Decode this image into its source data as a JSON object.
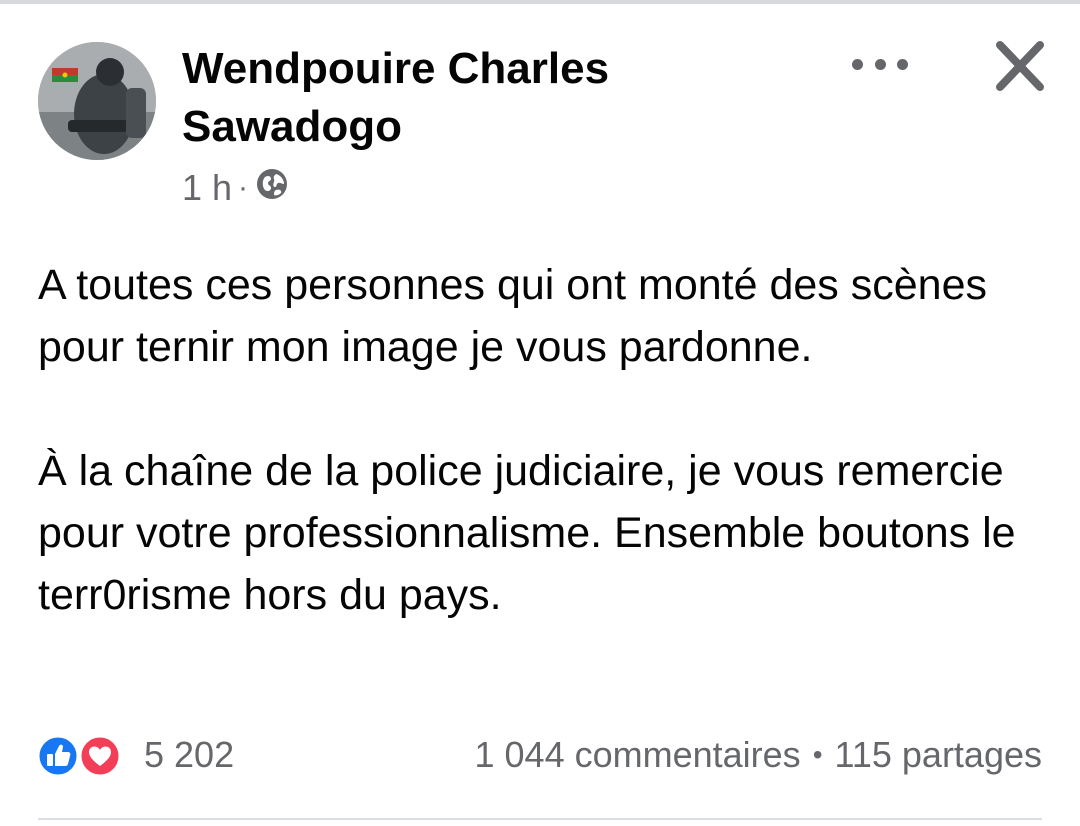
{
  "post": {
    "author_name": "Wendpouire Charles Sawadogo",
    "time": "1 h",
    "separator": "·",
    "privacy_icon": "globe-icon",
    "paragraphs": [
      "A toutes ces personnes qui ont monté des scènes pour ternir mon image je vous pardonne.",
      "À la chaîne de la police judiciaire, je vous remercie pour votre professionnalisme. Ensemble boutons le terr0risme hors du pays."
    ]
  },
  "header": {
    "more_icon": "more-horizontal-icon",
    "close_icon": "close-icon"
  },
  "footer": {
    "reaction_icons": [
      "like-reaction-icon",
      "love-reaction-icon"
    ],
    "reaction_count": "5 202",
    "comments": "1 044 commentaires",
    "bullet": "•",
    "shares": "115 partages"
  },
  "colors": {
    "text": "#050505",
    "secondary_text": "#65676b",
    "like_blue": "#1877f2",
    "love_red": "#f33e58",
    "divider": "#dadde1"
  }
}
